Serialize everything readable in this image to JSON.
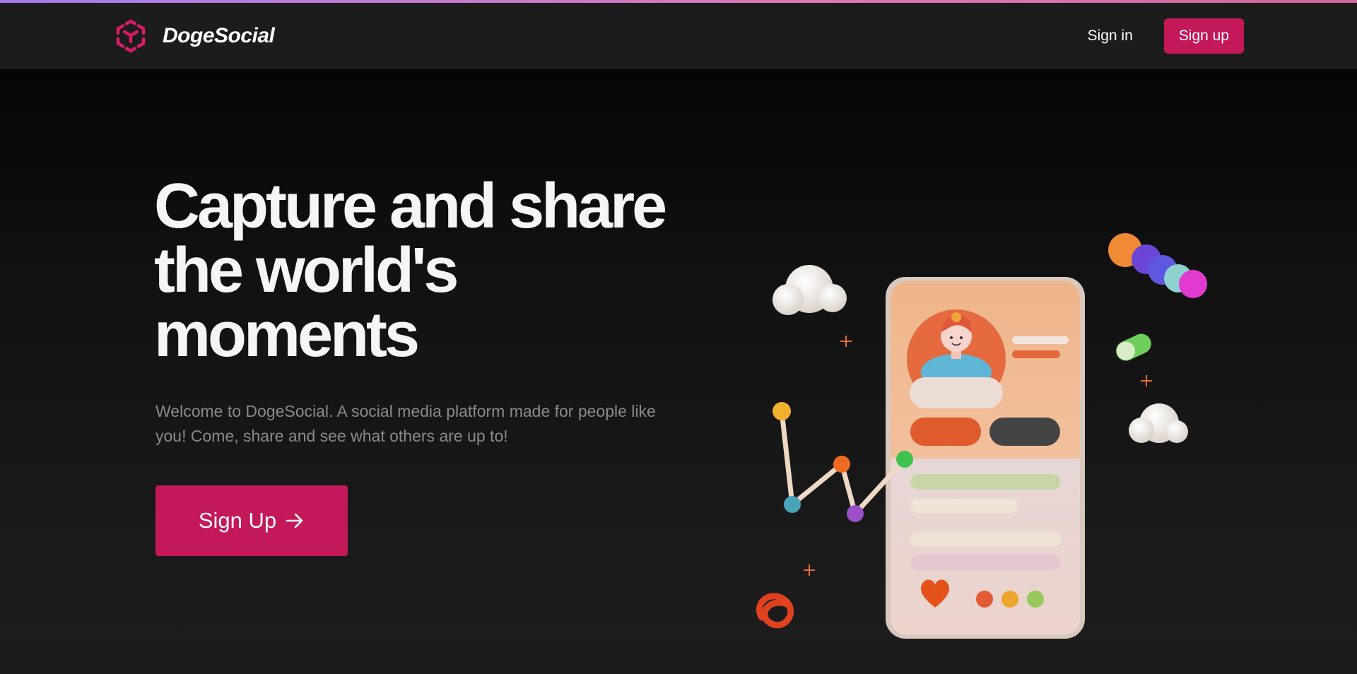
{
  "app": {
    "brand_name": "DogeSocial",
    "accent_color": "#c3185a",
    "top_gradient": [
      "#a67cf0",
      "#e07ab8"
    ]
  },
  "nav": {
    "signin_label": "Sign in",
    "signup_label": "Sign up"
  },
  "hero": {
    "title": "Capture and share the world's moments",
    "subtitle": "Welcome to DogeSocial. A social media platform made for people like you! Come, share and see what others are up to!",
    "cta_label": "Sign Up"
  },
  "icons": {
    "logo": "hexagon-cube-logo-icon",
    "cta_arrow": "arrow-right-icon"
  }
}
